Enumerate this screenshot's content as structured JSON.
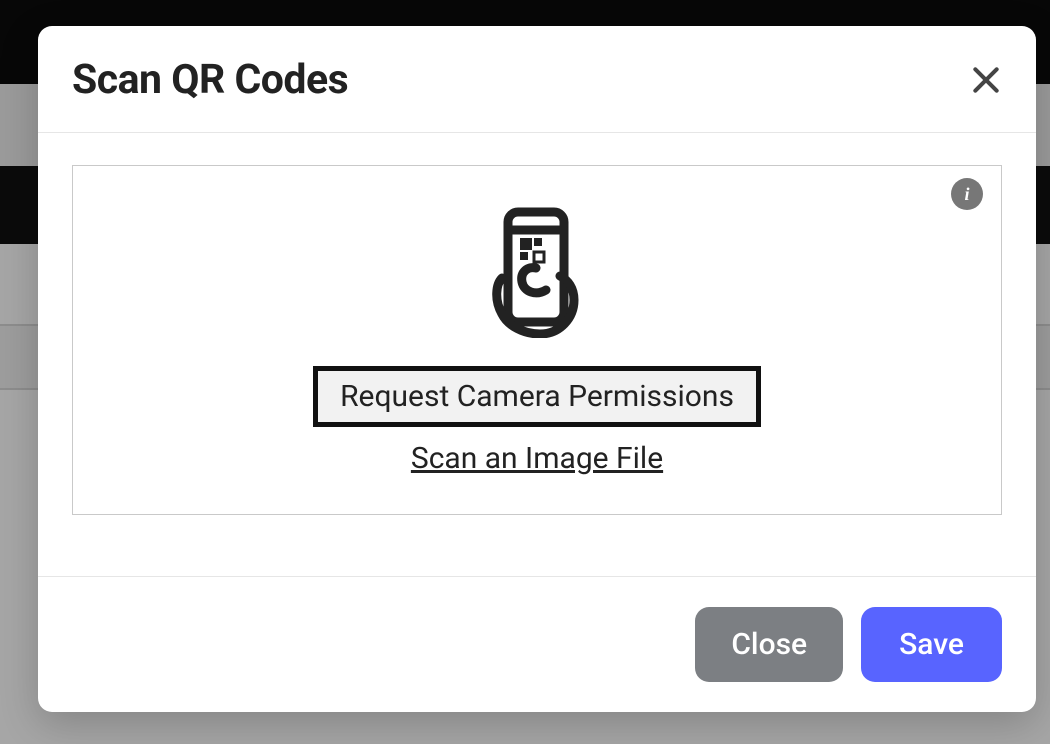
{
  "modal": {
    "title": "Scan QR Codes",
    "request_permissions_label": "Request Camera Permissions",
    "scan_image_link_label": "Scan an Image File",
    "info_char": "i"
  },
  "footer": {
    "close_label": "Close",
    "save_label": "Save"
  },
  "icons": {
    "close": "close-icon",
    "info": "info-icon",
    "phone_qr": "phone-qr-icon"
  }
}
